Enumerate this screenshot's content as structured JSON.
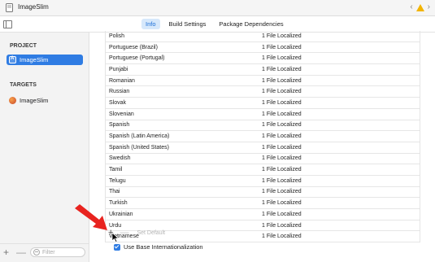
{
  "window": {
    "title": "ImageSlim",
    "nav_back": "‹",
    "nav_forward": "›"
  },
  "tabs": [
    {
      "label": "Info",
      "active": true
    },
    {
      "label": "Build Settings",
      "active": false
    },
    {
      "label": "Package Dependencies",
      "active": false
    }
  ],
  "sidebar": {
    "project_header": "PROJECT",
    "project_item": "ImageSlim",
    "targets_header": "TARGETS",
    "target_item": "ImageSlim",
    "add": "+",
    "remove": "—",
    "filter_placeholder": "Filter"
  },
  "localizations": [
    {
      "language": "Polish",
      "status": "1 File Localized"
    },
    {
      "language": "Portuguese (Brazil)",
      "status": "1 File Localized"
    },
    {
      "language": "Portuguese (Portugal)",
      "status": "1 File Localized"
    },
    {
      "language": "Punjabi",
      "status": "1 File Localized"
    },
    {
      "language": "Romanian",
      "status": "1 File Localized"
    },
    {
      "language": "Russian",
      "status": "1 File Localized"
    },
    {
      "language": "Slovak",
      "status": "1 File Localized"
    },
    {
      "language": "Slovenian",
      "status": "1 File Localized"
    },
    {
      "language": "Spanish",
      "status": "1 File Localized"
    },
    {
      "language": "Spanish (Latin America)",
      "status": "1 File Localized"
    },
    {
      "language": "Spanish (United States)",
      "status": "1 File Localized"
    },
    {
      "language": "Swedish",
      "status": "1 File Localized"
    },
    {
      "language": "Tamil",
      "status": "1 File Localized"
    },
    {
      "language": "Telugu",
      "status": "1 File Localized"
    },
    {
      "language": "Thai",
      "status": "1 File Localized"
    },
    {
      "language": "Turkish",
      "status": "1 File Localized"
    },
    {
      "language": "Ukrainian",
      "status": "1 File Localized"
    },
    {
      "language": "Urdu",
      "status": "1 File Localized"
    },
    {
      "language": "Vietnamese",
      "status": "1 File Localized"
    }
  ],
  "controls": {
    "add": "+",
    "remove": "—",
    "set_default": "Set Default",
    "base_internationalization": "Use Base Internationalization",
    "base_internationalization_checked": true
  },
  "colors": {
    "accent": "#2f7ce3",
    "tab_active_bg": "#d6e8fb",
    "warning": "#f2b400",
    "annotation_arrow": "#e8231f"
  }
}
